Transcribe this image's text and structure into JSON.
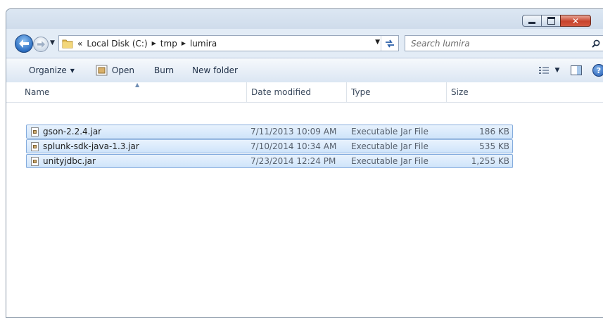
{
  "window": {
    "controls": {
      "minimize": "minimize",
      "maximize": "maximize",
      "close": "close"
    }
  },
  "address": {
    "overflow": "«",
    "crumbs": [
      "Local Disk (C:)",
      "tmp",
      "lumira"
    ]
  },
  "search": {
    "placeholder": "Search lumira"
  },
  "toolbar": {
    "organize_label": "Organize",
    "open_label": "Open",
    "burn_label": "Burn",
    "new_folder_label": "New folder"
  },
  "columns": {
    "name": "Name",
    "date": "Date modified",
    "type": "Type",
    "size": "Size"
  },
  "files": [
    {
      "name": "gson-2.2.4.jar",
      "date": "7/11/2013 10:09 AM",
      "type": "Executable Jar File",
      "size": "186 KB"
    },
    {
      "name": "splunk-sdk-java-1.3.jar",
      "date": "7/10/2014 10:34 AM",
      "type": "Executable Jar File",
      "size": "535 KB"
    },
    {
      "name": "unityjdbc.jar",
      "date": "7/23/2014 12:24 PM",
      "type": "Executable Jar File",
      "size": "1,255 KB"
    }
  ],
  "colors": {
    "selection_fill": "#cfe4fa",
    "selection_border": "#84acdd",
    "window_frame": "#e3ecf6"
  }
}
